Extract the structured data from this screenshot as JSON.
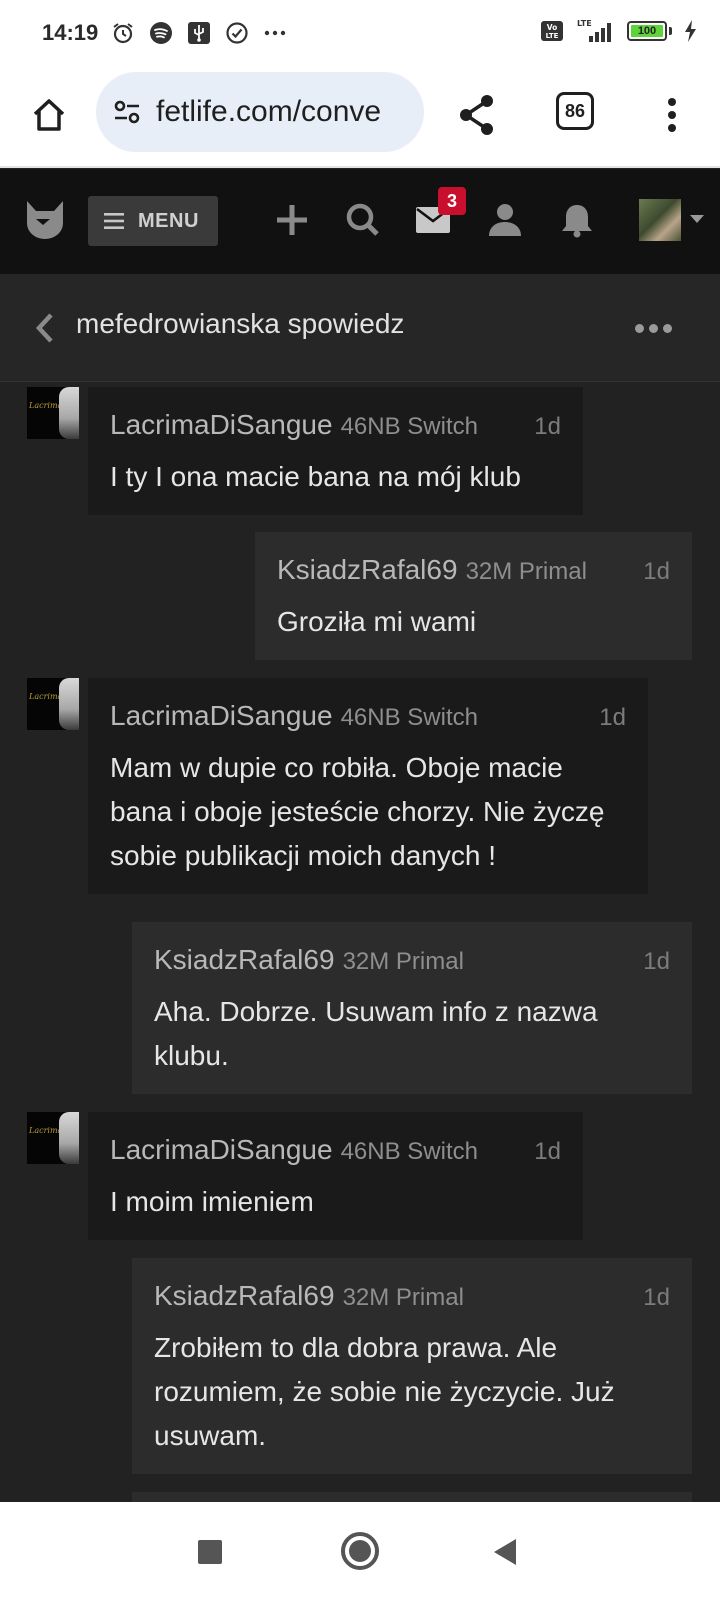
{
  "status_bar": {
    "time": "14:19",
    "battery_level": "100",
    "network": "LTE",
    "volte": "Vo LTE",
    "left_icons": [
      "alarm-icon",
      "spotify-icon",
      "usb-icon",
      "check-circle-icon",
      "more-dots-icon"
    ],
    "right_icons": [
      "volte-icon",
      "signal-icon",
      "battery-icon",
      "charging-icon"
    ]
  },
  "browser": {
    "url": "fetlife.com/conve",
    "tab_count": "86"
  },
  "site_nav": {
    "menu_label": "MENU",
    "mail_badge": "3",
    "accent_color": "#c8102e"
  },
  "conversation": {
    "title": "mefedrowianska spowiedz"
  },
  "messages": [
    {
      "side": "theirs",
      "name": "LacrimaDiSangue",
      "info": "46NB Switch",
      "time": "1d",
      "text": "I ty I ona macie bana na mój klub"
    },
    {
      "side": "mine",
      "name": "KsiadzRafal69",
      "info": "32M Primal",
      "time": "1d",
      "text": "Groziła mi wami"
    },
    {
      "side": "theirs",
      "name": "LacrimaDiSangue",
      "info": "46NB Switch",
      "time": "1d",
      "text": "Mam w dupie co robiła. Oboje macie bana i oboje jesteście chorzy. Nie życzę sobie publikacji moich danych !"
    },
    {
      "side": "mine",
      "name": "KsiadzRafal69",
      "info": "32M Primal",
      "time": "1d",
      "text": "Aha. Dobrze. Usuwam info z nazwa klubu."
    },
    {
      "side": "theirs",
      "name": "LacrimaDiSangue",
      "info": "46NB Switch",
      "time": "1d",
      "text": "I moim imieniem"
    },
    {
      "side": "mine",
      "name": "KsiadzRafal69",
      "info": "32M Primal",
      "time": "1d",
      "text": "Zrobiłem to dla dobra prawa. Ale rozumiem, że sobie nie życzycie. Już usuwam."
    }
  ]
}
